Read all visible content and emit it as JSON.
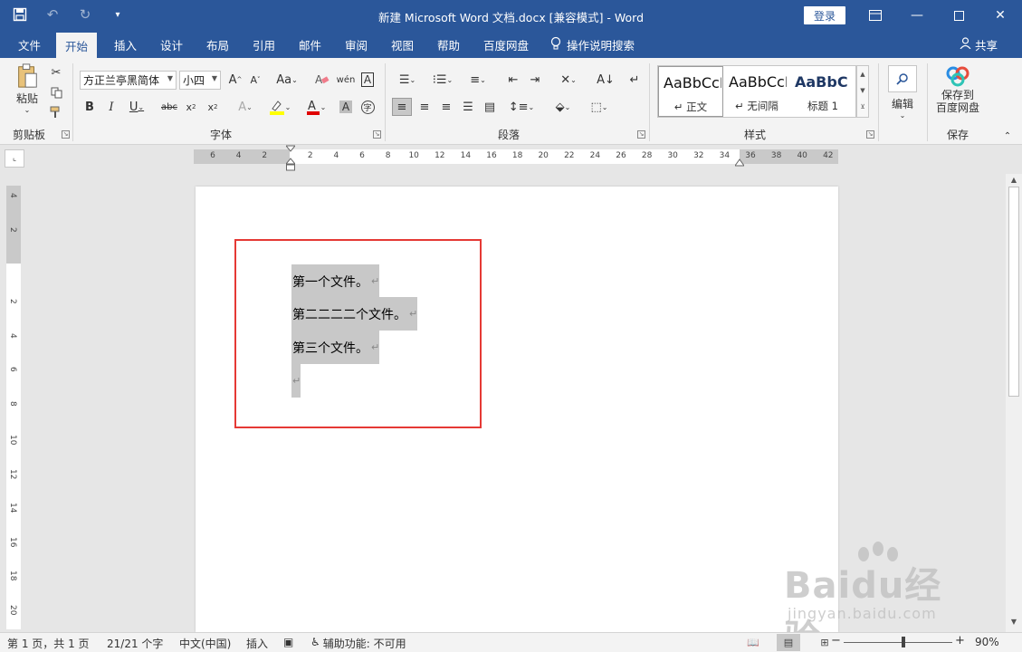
{
  "window": {
    "title": "新建 Microsoft Word 文档.docx [兼容模式] - Word",
    "login_label": "登录"
  },
  "quick_access": {
    "icons": [
      "save-icon",
      "undo-icon",
      "redo-icon",
      "customize-icon"
    ]
  },
  "tabs": [
    {
      "label": "文件"
    },
    {
      "label": "开始",
      "active": true
    },
    {
      "label": "插入"
    },
    {
      "label": "设计"
    },
    {
      "label": "布局"
    },
    {
      "label": "引用"
    },
    {
      "label": "邮件"
    },
    {
      "label": "审阅"
    },
    {
      "label": "视图"
    },
    {
      "label": "帮助"
    },
    {
      "label": "百度网盘"
    }
  ],
  "tell_me": "操作说明搜索",
  "share_label": "共享",
  "ribbon": {
    "clipboard": {
      "label": "剪贴板",
      "paste_label": "粘贴"
    },
    "font": {
      "label": "字体",
      "font_name": "方正兰亭黑简体",
      "font_size": "小四",
      "font_color": "#e00000",
      "highlight_color": "#ffff00"
    },
    "paragraph": {
      "label": "段落"
    },
    "styles": {
      "label": "样式",
      "items": [
        {
          "sample": "AaBbCcI",
          "name": "↵ 正文"
        },
        {
          "sample": "AaBbCcI",
          "name": "↵ 无间隔"
        },
        {
          "sample": "AaBbC",
          "name": "标题 1"
        }
      ]
    },
    "editing": {
      "label": "编辑"
    },
    "save": {
      "label": "保存",
      "button_label_line1": "保存到",
      "button_label_line2": "百度网盘"
    }
  },
  "ruler": {
    "horizontal_ticks": [
      "6",
      "4",
      "2",
      "2",
      "4",
      "6",
      "8",
      "10",
      "12",
      "14",
      "16",
      "18",
      "20",
      "22",
      "24",
      "26",
      "28",
      "30",
      "32",
      "34",
      "36",
      "38",
      "40",
      "42"
    ],
    "vertical_ticks": [
      "4",
      "2",
      "2",
      "4",
      "6",
      "8",
      "10",
      "12",
      "14",
      "16",
      "18",
      "20"
    ]
  },
  "document": {
    "paragraphs": [
      "第一个文件。",
      "第二二二二个文件。",
      "第三个文件。",
      ""
    ],
    "paragraph_mark": "↵"
  },
  "status": {
    "page": "第 1 页，共 1 页",
    "words": "21/21 个字",
    "language": "中文(中国)",
    "mode": "插入",
    "accessibility": "辅助功能: 不可用",
    "zoom": "90%"
  },
  "watermark": {
    "brand": "Baidu经验",
    "url": "jingyan.baidu.com"
  },
  "colors": {
    "accent": "#2b579a",
    "highlight_box": "#e53935"
  }
}
